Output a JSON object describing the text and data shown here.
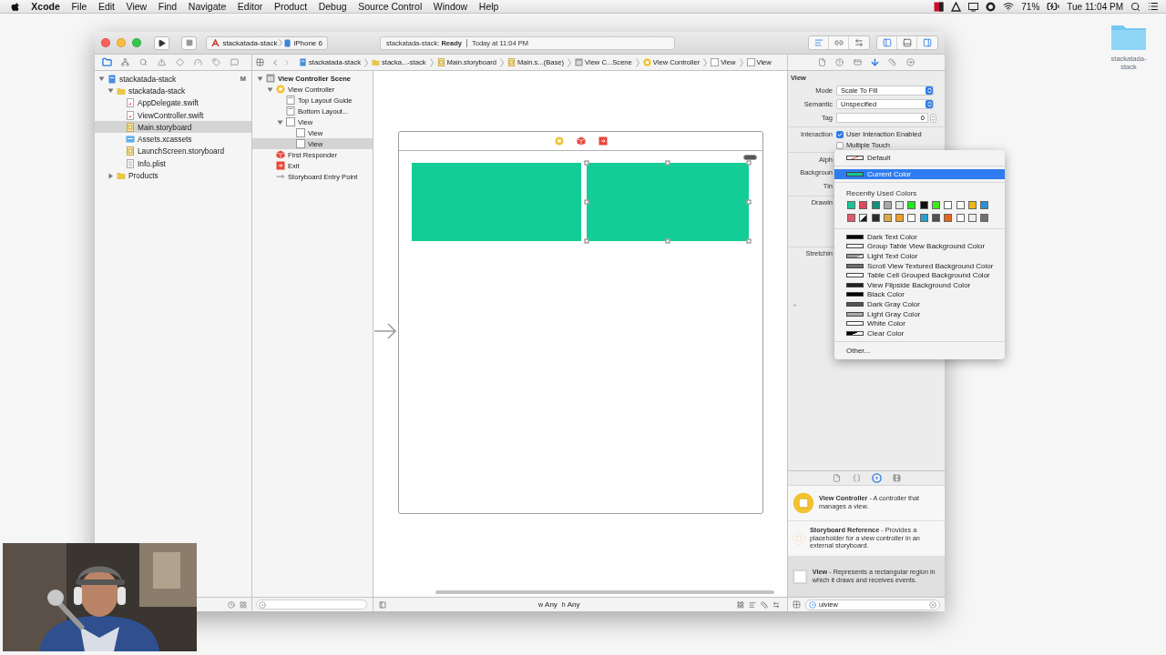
{
  "menu_bar": {
    "app": "Xcode",
    "items": [
      "File",
      "Edit",
      "View",
      "Find",
      "Navigate",
      "Editor",
      "Product",
      "Debug",
      "Source Control",
      "Window",
      "Help"
    ],
    "battery": "71%",
    "clock": "Tue 11:04 PM"
  },
  "desktop": {
    "folder_label": "stackatada-stack"
  },
  "toolbar": {
    "scheme": "stackatada-stack",
    "device": "iPhone 6",
    "status": "stackatada-stack: **Ready**",
    "status_time": "Today at 11:04 PM",
    "editor_buttons": [
      {
        "kind": "standard",
        "selected": true
      },
      {
        "kind": "assistant",
        "selected": false
      },
      {
        "kind": "version",
        "selected": false
      }
    ],
    "panel_buttons": [
      {
        "kind": "navigator",
        "selected": true
      },
      {
        "kind": "debug",
        "selected": false
      },
      {
        "kind": "utilities",
        "selected": true
      }
    ]
  },
  "navigator": {
    "tabs": [
      {
        "kind": "project",
        "selected": true
      },
      {
        "kind": "symbol",
        "selected": false
      },
      {
        "kind": "find",
        "selected": false
      },
      {
        "kind": "issue",
        "selected": false
      },
      {
        "kind": "test",
        "selected": false
      },
      {
        "kind": "debug",
        "selected": false
      },
      {
        "kind": "breakpoint",
        "selected": false
      },
      {
        "kind": "report",
        "selected": false
      }
    ],
    "tree": [
      {
        "label": "stackatada-stack",
        "kind": "project",
        "badge": "M",
        "expanded": true,
        "selected": false,
        "children": [
          {
            "label": "stackatada-stack",
            "kind": "folder",
            "expanded": true,
            "selected": false,
            "children": [
              {
                "label": "AppDelegate.swift",
                "kind": "swift",
                "selected": false
              },
              {
                "label": "ViewController.swift",
                "kind": "swift",
                "selected": false
              },
              {
                "label": "Main.storyboard",
                "kind": "storyboard",
                "selected": true
              },
              {
                "label": "Assets.xcassets",
                "kind": "assets",
                "selected": false
              },
              {
                "label": "LaunchScreen.storyboard",
                "kind": "storyboard",
                "selected": false
              },
              {
                "label": "Info.plist",
                "kind": "plist",
                "selected": false
              }
            ]
          },
          {
            "label": "Products",
            "kind": "folder",
            "expanded": false,
            "selected": false
          }
        ]
      }
    ]
  },
  "jump_bar": [
    {
      "label": "stackatada-stack",
      "kind": "project"
    },
    {
      "label": "stacka...-stack",
      "kind": "folder"
    },
    {
      "label": "Main.storyboard",
      "kind": "storyboard"
    },
    {
      "label": "Main.s...(Base)",
      "kind": "storyboard"
    },
    {
      "label": "View C...Scene",
      "kind": "scene"
    },
    {
      "label": "View Controller",
      "kind": "controller"
    },
    {
      "label": "View",
      "kind": "view"
    },
    {
      "label": "View",
      "kind": "view"
    }
  ],
  "outline": {
    "tree": [
      {
        "label": "View Controller Scene",
        "kind": "scene",
        "expanded": true,
        "selected": false,
        "children": [
          {
            "label": "View Controller",
            "kind": "controller",
            "expanded": true,
            "selected": false,
            "children": [
              {
                "label": "Top Layout Guide",
                "kind": "guide",
                "selected": false
              },
              {
                "label": "Bottom Layout...",
                "kind": "guide",
                "selected": false
              },
              {
                "label": "View",
                "kind": "view",
                "expanded": true,
                "selected": false,
                "children": [
                  {
                    "label": "View",
                    "kind": "view",
                    "selected": false
                  },
                  {
                    "label": "View",
                    "kind": "view",
                    "selected": true
                  }
                ]
              }
            ]
          },
          {
            "label": "First Responder",
            "kind": "responder",
            "selected": false
          },
          {
            "label": "Exit",
            "kind": "exit",
            "selected": false
          },
          {
            "label": "Storyboard Entry Point",
            "kind": "entry",
            "selected": false
          }
        ]
      }
    ]
  },
  "canvas": {
    "size_classes": [
      {
        "label": "w",
        "value": "Any"
      },
      {
        "label": "h",
        "value": "Any"
      }
    ]
  },
  "inspector": {
    "tabs": [
      {
        "kind": "file",
        "selected": false
      },
      {
        "kind": "help",
        "selected": false
      },
      {
        "kind": "identity",
        "selected": false
      },
      {
        "kind": "attributes",
        "selected": true
      },
      {
        "kind": "size",
        "selected": false
      },
      {
        "kind": "connections",
        "selected": false
      }
    ],
    "title": "View",
    "rows": [
      {
        "kind": "select",
        "label": "Mode",
        "value": "Scale To Fill"
      },
      {
        "kind": "select",
        "label": "Semantic",
        "value": "Unspecified"
      },
      {
        "kind": "stepper",
        "label": "Tag",
        "value": "0"
      },
      {
        "kind": "checks",
        "label": "Interaction",
        "options": [
          {
            "label": "User Interaction Enabled",
            "checked": true
          },
          {
            "label": "Multiple Touch",
            "checked": false
          }
        ]
      },
      {
        "kind": "label",
        "label": "Alph"
      },
      {
        "kind": "label",
        "label": "Backgroun"
      },
      {
        "kind": "label",
        "label": "Tin"
      },
      {
        "kind": "block",
        "label": "Drawin"
      },
      {
        "kind": "block",
        "label": "Stretchin"
      }
    ],
    "add_button": "+"
  },
  "color_menu": {
    "items": [
      {
        "label": "Default",
        "color": "#ffffff",
        "kind": "none",
        "selected": false
      },
      {
        "label": "Current Color",
        "color": "#19c596",
        "kind": "solid",
        "selected": true
      }
    ],
    "recent_title": "Recently Used Colors",
    "recent": [
      {
        "color": "#19c596",
        "kind": "solid"
      },
      {
        "color": "#e0475e",
        "kind": "solid"
      },
      {
        "color": "#138f7a",
        "kind": "solid"
      },
      {
        "color": "#a8a8a8",
        "kind": "solid"
      },
      {
        "color": "#e6e6e6",
        "kind": "solid"
      },
      {
        "color": "#1ee91e",
        "kind": "solid"
      },
      {
        "color": "#111111",
        "kind": "solid"
      },
      {
        "color": "#3fe81b",
        "kind": "solid"
      },
      {
        "color": "#ffffff",
        "kind": "solid"
      },
      {
        "color": "#ffffff",
        "kind": "solid"
      },
      {
        "color": "#f0b418",
        "kind": "solid"
      },
      {
        "color": "#2f8fd0",
        "kind": "solid"
      },
      {
        "color": "#e55a6a",
        "kind": "solid"
      },
      {
        "color": "#1a1a1a",
        "kind": "split"
      },
      {
        "color": "#2a2a2a",
        "kind": "solid"
      },
      {
        "color": "#e0a84a",
        "kind": "solid"
      },
      {
        "color": "#f0a020",
        "kind": "solid"
      },
      {
        "color": "#ffffff",
        "kind": "solid"
      },
      {
        "color": "#2a9ed0",
        "kind": "solid"
      },
      {
        "color": "#505050",
        "kind": "solid"
      },
      {
        "color": "#e8641e",
        "kind": "solid"
      },
      {
        "color": "#ffffff",
        "kind": "solid"
      },
      {
        "color": "#eeeeee",
        "kind": "solid"
      },
      {
        "color": "#707070",
        "kind": "solid"
      }
    ],
    "named": [
      {
        "label": "Dark Text Color",
        "color": "#000000",
        "kind": "solid"
      },
      {
        "label": "Group Table View Background Color",
        "color": "#efeff4",
        "kind": "solid"
      },
      {
        "label": "Light Text Color",
        "color": "#999999",
        "kind": "fade"
      },
      {
        "label": "Scroll View Textured Background Color",
        "color": "#6f6f6f",
        "kind": "solid"
      },
      {
        "label": "Table Cell Grouped Background Color",
        "color": "#ffffff",
        "kind": "solid"
      },
      {
        "label": "View Flipside Background Color",
        "color": "#1f2124",
        "kind": "solid"
      },
      {
        "label": "Black Color",
        "color": "#000000",
        "kind": "solid"
      },
      {
        "label": "Dark Gray Color",
        "color": "#555555",
        "kind": "solid"
      },
      {
        "label": "Light Gray Color",
        "color": "#aaaaaa",
        "kind": "solid"
      },
      {
        "label": "White Color",
        "color": "#ffffff",
        "kind": "solid"
      },
      {
        "label": "Clear Color",
        "color": "#000000",
        "kind": "split"
      }
    ],
    "other": "Other..."
  },
  "library": {
    "tabs": [
      {
        "kind": "file",
        "selected": false
      },
      {
        "kind": "code",
        "selected": false
      },
      {
        "kind": "object",
        "selected": true
      },
      {
        "kind": "media",
        "selected": false
      }
    ],
    "items": [
      {
        "kind": "controller",
        "text": "**View Controller** - A controller that manages a view.",
        "selected": false
      },
      {
        "kind": "reference",
        "text": "**Storyboard Reference** - Provides a placeholder for a view controller in an external storyboard.",
        "selected": false
      },
      {
        "kind": "view",
        "text": "**View** - Represents a rectangular region in which it draws and receives events.",
        "selected": true
      }
    ],
    "filter": "uiview"
  }
}
